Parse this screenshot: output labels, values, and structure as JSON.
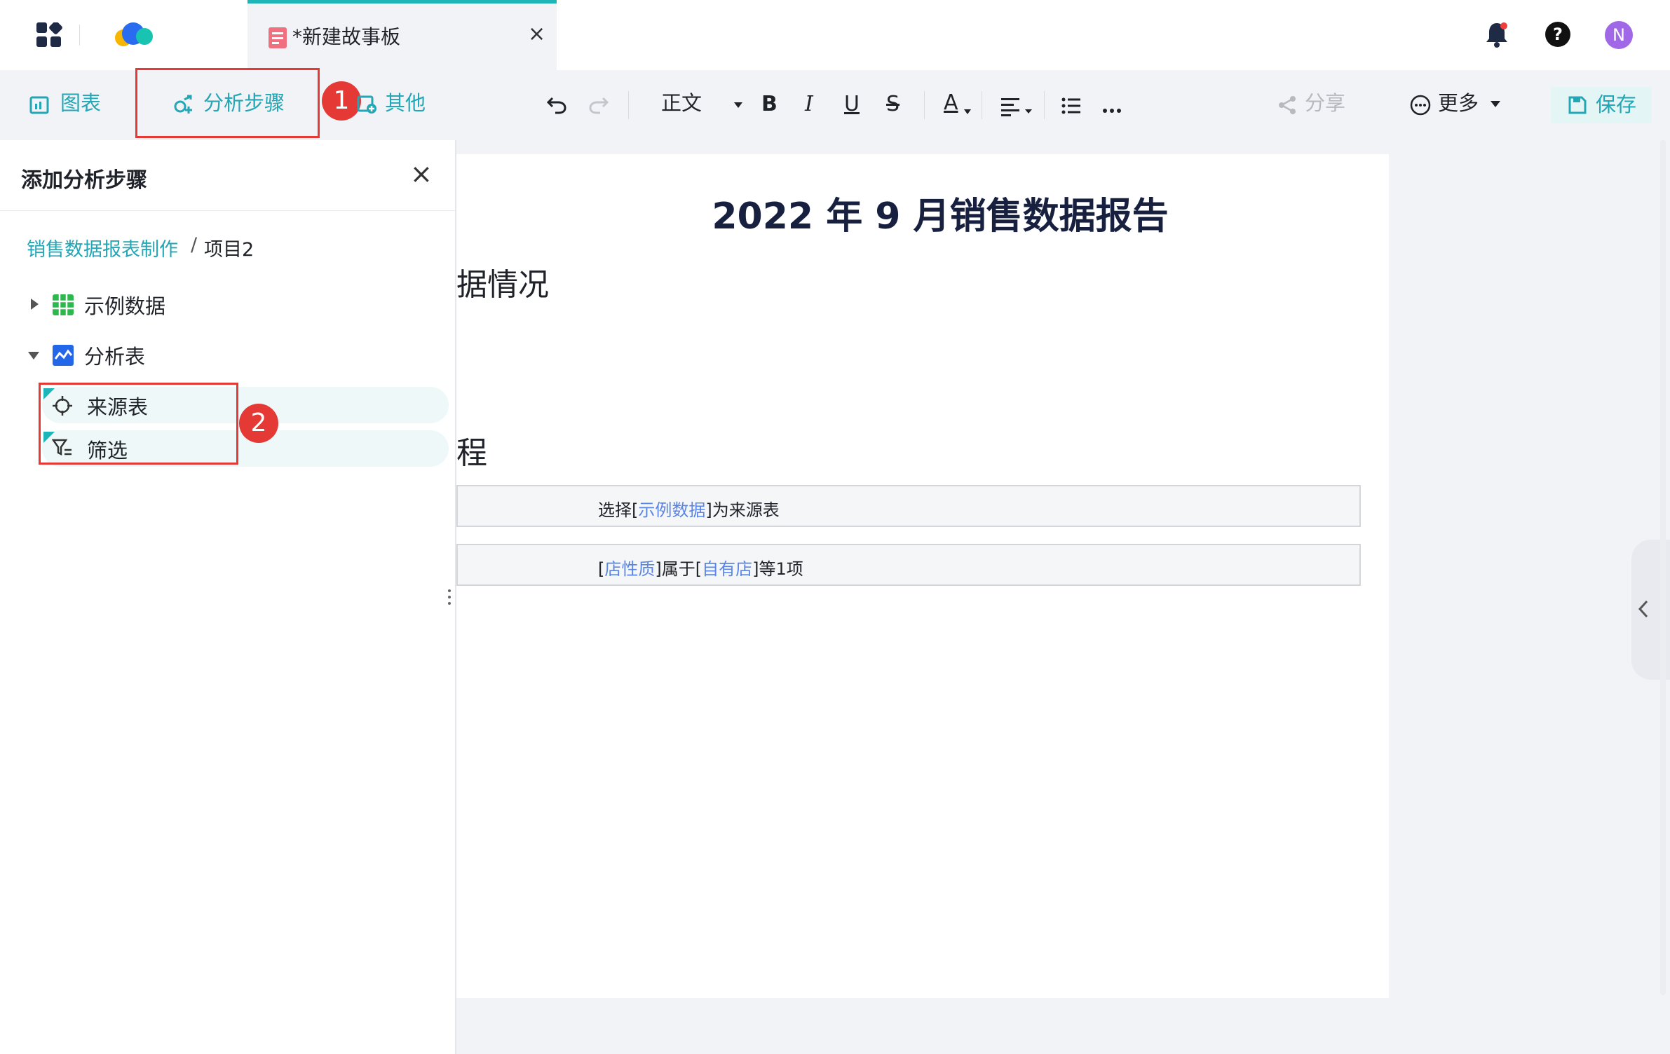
{
  "header": {
    "tab_title": "*新建故事板",
    "close_glyph": "×",
    "avatar_letter": "N"
  },
  "toolbar": {
    "chart_label": "图表",
    "analysis_label": "分析步骤",
    "other_label": "其他",
    "style_label": "正文",
    "bold": "B",
    "italic": "I",
    "underline": "U",
    "strike": "S",
    "font_color": "A",
    "share_label": "分享",
    "more_label": "更多",
    "save_label": "保存",
    "undo_icon": "undo-icon",
    "redo_icon": "redo-icon"
  },
  "annotations": {
    "badge1": "1",
    "badge2": "2"
  },
  "panel": {
    "title": "添加分析步骤",
    "breadcrumb_project": "销售数据报表制作",
    "breadcrumb_sep": "/",
    "breadcrumb_item": "项目2",
    "tree": {
      "node1": "示例数据",
      "node2": "分析表",
      "leaf1": "来源表",
      "leaf2": "筛选"
    }
  },
  "document": {
    "title": "2022 年 9 月销售数据报告",
    "heading1_fragment": "据情况",
    "heading2_fragment": "程",
    "step1": {
      "pre": "选择[",
      "link": "示例数据",
      "post": "]为来源表"
    },
    "step2": {
      "pre1": "[",
      "link1": "店性质",
      "mid": "]属于[",
      "link2": "自有店",
      "post": "]等1项"
    }
  },
  "colors": {
    "accent": "#1fb5b8",
    "teal_text": "#23a6b5",
    "annotation_red": "#e53935",
    "link": "#5b85e4",
    "avatar": "#a068e6"
  }
}
